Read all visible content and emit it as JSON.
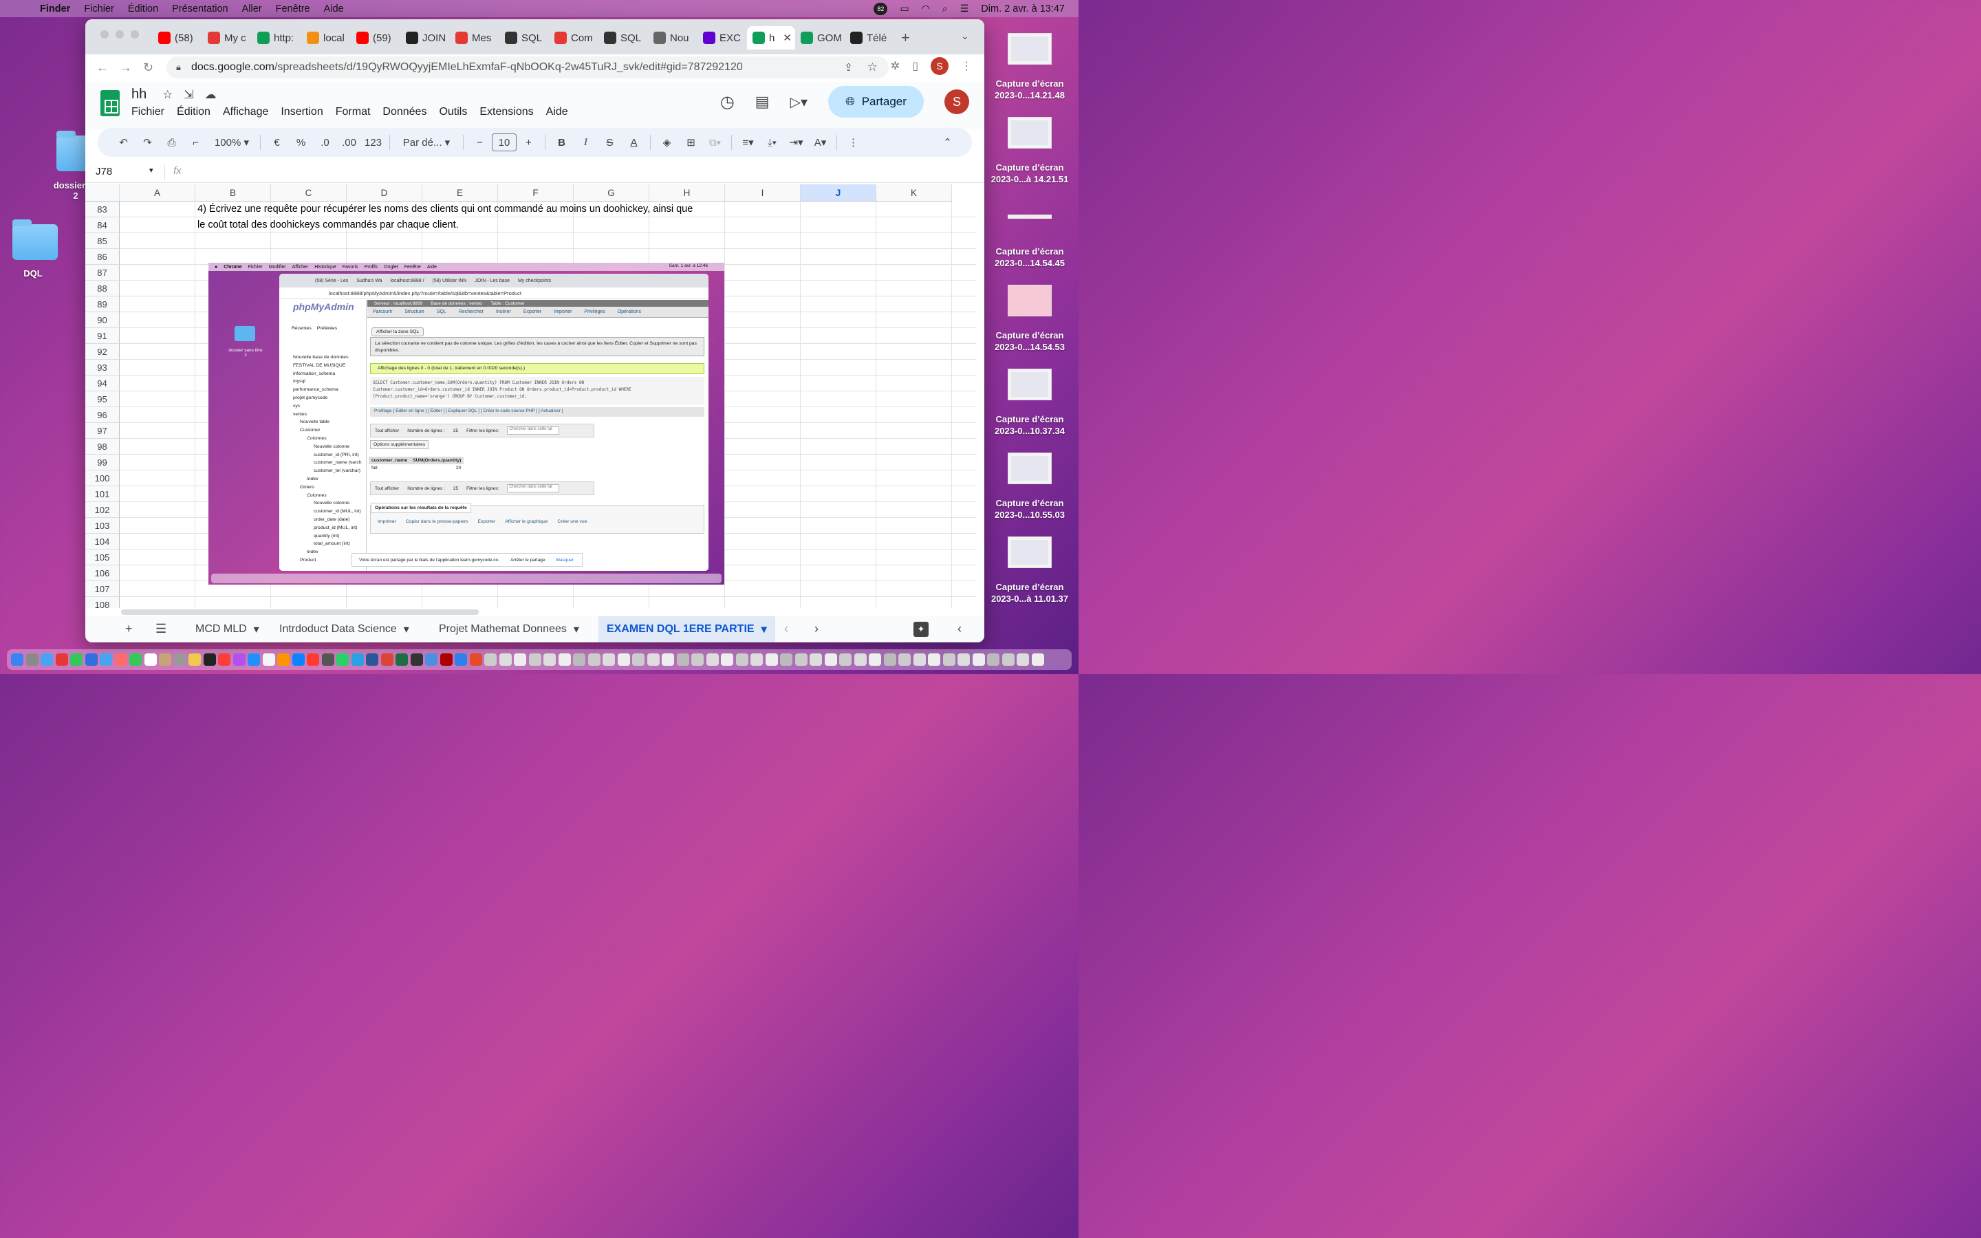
{
  "menubar": {
    "app": "Finder",
    "items": [
      "Fichier",
      "Édition",
      "Présentation",
      "Aller",
      "Fenêtre",
      "Aide"
    ],
    "badge": "82",
    "datetime": "Dim. 2 avr. à  13:47"
  },
  "desktop": {
    "folders": [
      {
        "label": "dossier sa\n2"
      },
      {
        "label": "DQL"
      }
    ],
    "screenshots": [
      {
        "line1": "Capture d’écran",
        "line2": "2023-0...14.21.48"
      },
      {
        "line1": "Capture d’écran",
        "line2": "2023-0...à 14.21.51"
      },
      {
        "line1": "Capture d’écran",
        "line2": "2023-0...14.54.45"
      },
      {
        "line1": "Capture d’écran",
        "line2": "2023-0...14.54.53"
      },
      {
        "line1": "Capture d’écran",
        "line2": "2023-0...10.37.34"
      },
      {
        "line1": "Capture d’écran",
        "line2": "2023-0...10.55.03"
      },
      {
        "line1": "Capture d’écran",
        "line2": "2023-0...à 11.01.37"
      }
    ]
  },
  "browser": {
    "tabs": [
      {
        "label": "(58)",
        "icon": "youtube-icon",
        "color": "#ff0000"
      },
      {
        "label": "My c",
        "icon": "gomycode-icon",
        "color": "#e53935"
      },
      {
        "label": "http:",
        "icon": "sheets-icon",
        "color": "#0f9d58"
      },
      {
        "label": "local",
        "icon": "phpmyadmin-icon",
        "color": "#f29111"
      },
      {
        "label": "(59)",
        "icon": "youtube-icon",
        "color": "#ff0000"
      },
      {
        "label": "JOIN",
        "icon": "amazon-icon",
        "color": "#222222"
      },
      {
        "label": "Mes",
        "icon": "gomycode-icon",
        "color": "#e53935"
      },
      {
        "label": "SQL",
        "icon": "sql-icon",
        "color": "#333333"
      },
      {
        "label": "Com",
        "icon": "gomycode-icon",
        "color": "#e53935"
      },
      {
        "label": "SQL",
        "icon": "sql-icon",
        "color": "#333333"
      },
      {
        "label": "Nou",
        "icon": "globe-icon",
        "color": "#666666"
      },
      {
        "label": "EXC",
        "icon": "yahoo-icon",
        "color": "#5f01d1"
      },
      {
        "label": "h",
        "icon": "sheets-icon",
        "color": "#0f9d58",
        "active": true
      },
      {
        "label": "GOM",
        "icon": "sheets-icon",
        "color": "#0f9d58"
      },
      {
        "label": "Télé",
        "icon": "github-icon",
        "color": "#222222"
      }
    ],
    "url_host": "docs.google.com",
    "url_path": "/spreadsheets/d/19QyRWOQyyjEMIeLhExmfaF-qNbOOKq-2w45TuRJ_svk/edit#gid=787292120",
    "profile_initial": "S"
  },
  "sheets": {
    "title": "hh",
    "menus": [
      "Fichier",
      "Édition",
      "Affichage",
      "Insertion",
      "Format",
      "Données",
      "Outils",
      "Extensions",
      "Aide"
    ],
    "share_label": "Partager",
    "avatar": "S",
    "toolbar": {
      "zoom": "100%",
      "currency": "€",
      "percent": "%",
      "dec_less": ".0",
      "dec_more": ".00",
      "number": "123",
      "font": "Par dé...",
      "font_size": "10"
    },
    "name_box": "J78",
    "fx": "fx",
    "columns": [
      "A",
      "B",
      "C",
      "D",
      "E",
      "F",
      "G",
      "H",
      "I",
      "J",
      "K"
    ],
    "selected_column": "J",
    "rows": [
      "83",
      "84",
      "85",
      "86",
      "87",
      "88",
      "89",
      "90",
      "91",
      "92",
      "93",
      "94",
      "95",
      "96",
      "97",
      "98",
      "99",
      "100",
      "101",
      "102",
      "103",
      "104",
      "105",
      "106",
      "107",
      "108"
    ],
    "cell_b83": "4) Écrivez une requête pour récupérer les noms des clients qui ont commandé au moins un doohickey, ainsi que",
    "cell_b84": "le coût total des doohickeys commandés par chaque client.",
    "sheet_tabs": [
      "MCD MLD",
      "Intrdoduct Data Science",
      "Projet Mathemat Donnees",
      "EXAMEN DQL 1ERE PARTIE"
    ]
  },
  "embedded": {
    "menubar": [
      "Chrome",
      "Fichier",
      "Modifier",
      "Afficher",
      "Historique",
      "Favoris",
      "Profils",
      "Onglet",
      "Fenêtre",
      "Aide"
    ],
    "datetime": "Sam. 1 avr. à  12:46",
    "tabs": [
      "(58) Série - Les",
      "Sudha's Wa",
      "localhost:8888 /",
      "(58) Utiliser INN",
      "JOIN - Les base",
      "My checkpoints"
    ],
    "url": "localhost:8888/phpMyAdmin5/index.php?route=/table/sql&db=ventes&table=Product",
    "desktop_folder": "dossier sans titre\n2",
    "pma_logo": "phpMyAdmin",
    "recent": "Récentes",
    "favorites": "Préférées",
    "tree": [
      "Nouvelle base de données",
      "FESTIVAL DE MUSIQUE",
      "information_schema",
      "mysql",
      "performance_schema",
      "projet gomycode",
      "sys",
      "ventes",
      "Nouvelle table",
      "Customer",
      "Colonnes",
      "Nouvelle colonne",
      "customer_id (PRI, int)",
      "customer_name (varch",
      "customer_tel (varchar)",
      "Index",
      "Orders",
      "Colonnes",
      "Nouvelle colonne",
      "customer_id (MUL, int)",
      "order_date (date)",
      "product_id (MUL, int)",
      "quantity (int)",
      "total_amount (int)",
      "Index",
      "Product"
    ],
    "breadcrumb": [
      "Serveur : localhost:8889",
      "Base de données : ventes",
      "Table : Customer"
    ],
    "nav": [
      "Parcourir",
      "Structure",
      "SQL",
      "Rechercher",
      "Insérer",
      "Exporter",
      "Importer",
      "Privilèges",
      "Opérations"
    ],
    "show_sql": "Afficher la zone SQL",
    "warning": "La sélection courante ne contient pas de colonne unique. Les grilles d'édition, les cases à cocher ainsi que les liens Éditer, Copier et Supprimer ne sont pas disponibles.",
    "success": "Affichage des lignes 0 - 0 (total de 1, traitement en 0.0020 seconde(s).)",
    "sql_line1": "SELECT Customer.customer_name,SUM(Orders.quantity) FROM Customer INNER JOIN Orders ON",
    "sql_line2": "Customer.customer_id=Orders.customer_id INNER JOIN Product ON Orders.product_id=Product.product_id WHERE",
    "sql_line3": "(Product.product_name='orange') GROUP BY Customer.customer_id;",
    "profiling": "Profilage [ Éditer en ligne ] [ Éditer ] [ Expliquer SQL ] [ Créer le code source PHP ] [ Actualiser ]",
    "show_all": "Tout afficher",
    "row_count_label": "Nombre de lignes :",
    "row_count": "25",
    "filter_label": "Filtrer les lignes:",
    "filter_placeholder": "Chercher dans cette tat",
    "extra_options": "Options supplémentaires",
    "table_headers": [
      "customer_name",
      "SUM(Orders.quantity)"
    ],
    "table_row": [
      "fall",
      "20"
    ],
    "ops_title": "Opérations sur les résultats de la requête",
    "ops": [
      "Imprimer",
      "Copier dans le presse-papiers",
      "Exporter",
      "Afficher le graphique",
      "Créer une vue"
    ],
    "share_msg": "Votre écran est partagé par le biais de l'application learn.gomycode.co.",
    "stop_share": "Arrêter le partage",
    "hide": "Masquer"
  }
}
